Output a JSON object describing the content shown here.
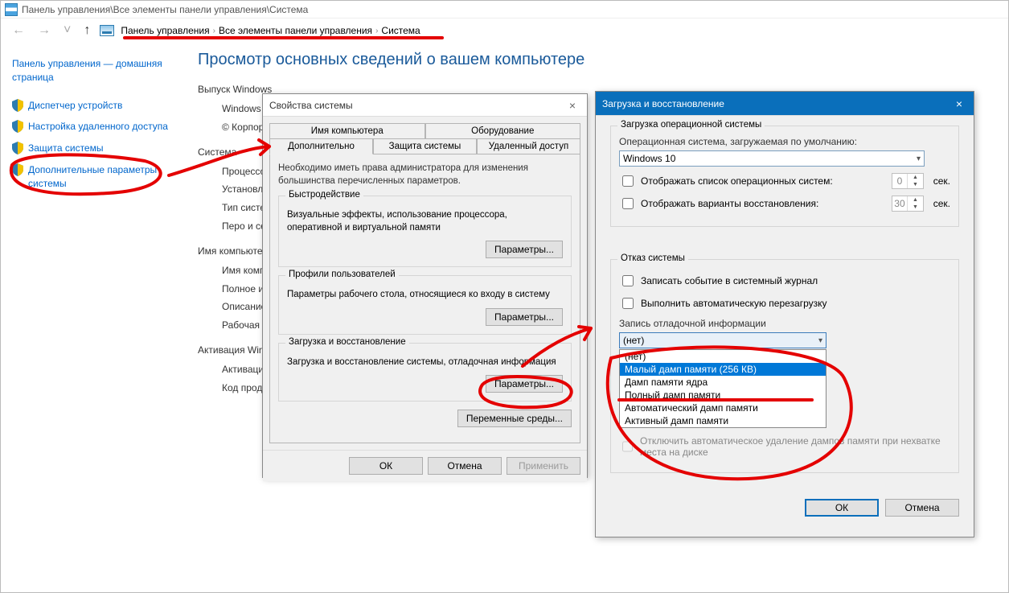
{
  "window": {
    "title": "Панель управления\\Все элементы панели управления\\Система",
    "breadcrumb": [
      "Панель управления",
      "Все элементы панели управления",
      "Система"
    ]
  },
  "sidebar": {
    "home": "Панель управления — домашняя страница",
    "items": [
      "Диспетчер устройств",
      "Настройка удаленного доступа",
      "Защита системы",
      "Дополнительные параметры системы"
    ]
  },
  "content": {
    "heading": "Просмотр основных сведений о вашем компьютере",
    "edition_head": "Выпуск Windows",
    "edition_lines": [
      "Windows 10",
      "© Корпорац"
    ],
    "system_head": "Система",
    "system_lines": [
      "Процессор:",
      "Установленн (ОЗУ):",
      "Тип системы",
      "Перо и сенс"
    ],
    "computer_head": "Имя компьютер",
    "computer_lines": [
      "Имя компь",
      "Полное имя",
      "Описание:",
      "Рабочая гру"
    ],
    "activation_head": "Активация Wind",
    "activation_lines": [
      "Активация W",
      "Код продукт"
    ]
  },
  "dlg1": {
    "title": "Свойства системы",
    "tabs_row1": [
      "Имя компьютера",
      "Оборудование"
    ],
    "tabs_row2": [
      "Дополнительно",
      "Защита системы",
      "Удаленный доступ"
    ],
    "active_tab": "Дополнительно",
    "note": "Необходимо иметь права администратора для изменения большинства перечисленных параметров.",
    "g1_title": "Быстродействие",
    "g1_desc": "Визуальные эффекты, использование процессора, оперативной и виртуальной памяти",
    "g2_title": "Профили пользователей",
    "g2_desc": "Параметры рабочего стола, относящиеся ко входу в систему",
    "g3_title": "Загрузка и восстановление",
    "g3_desc": "Загрузка и восстановление системы, отладочная информация",
    "btn_params": "Параметры...",
    "btn_envvars": "Переменные среды...",
    "btn_ok": "ОК",
    "btn_cancel": "Отмена",
    "btn_apply": "Применить"
  },
  "dlg2": {
    "title": "Загрузка и восстановление",
    "boot_head": "Загрузка операционной системы",
    "default_os_label": "Операционная система, загружаемая по умолчанию:",
    "default_os_value": "Windows 10",
    "cb_oslist": "Отображать список операционных систем:",
    "cb_recovery": "Отображать варианты восстановления:",
    "sec_unit": "сек.",
    "oslist_sec": "0",
    "recovery_sec": "30",
    "fail_head": "Отказ системы",
    "cb_writelog": "Записать событие в системный журнал",
    "cb_autoreboot": "Выполнить автоматическую перезагрузку",
    "dump_head": "Запись отладочной информации",
    "dump_selected": "(нет)",
    "dump_options": [
      "(нет)",
      "Малый дамп памяти (256 КВ)",
      "Дамп памяти ядра",
      "Полный дамп памяти",
      "Автоматический дамп памяти",
      "Активный дамп памяти"
    ],
    "dump_highlight_index": 1,
    "cb_autodelete": "Отключить автоматическое удаление дампов памяти при нехватке места на диске",
    "btn_ok": "ОК",
    "btn_cancel": "Отмена"
  }
}
